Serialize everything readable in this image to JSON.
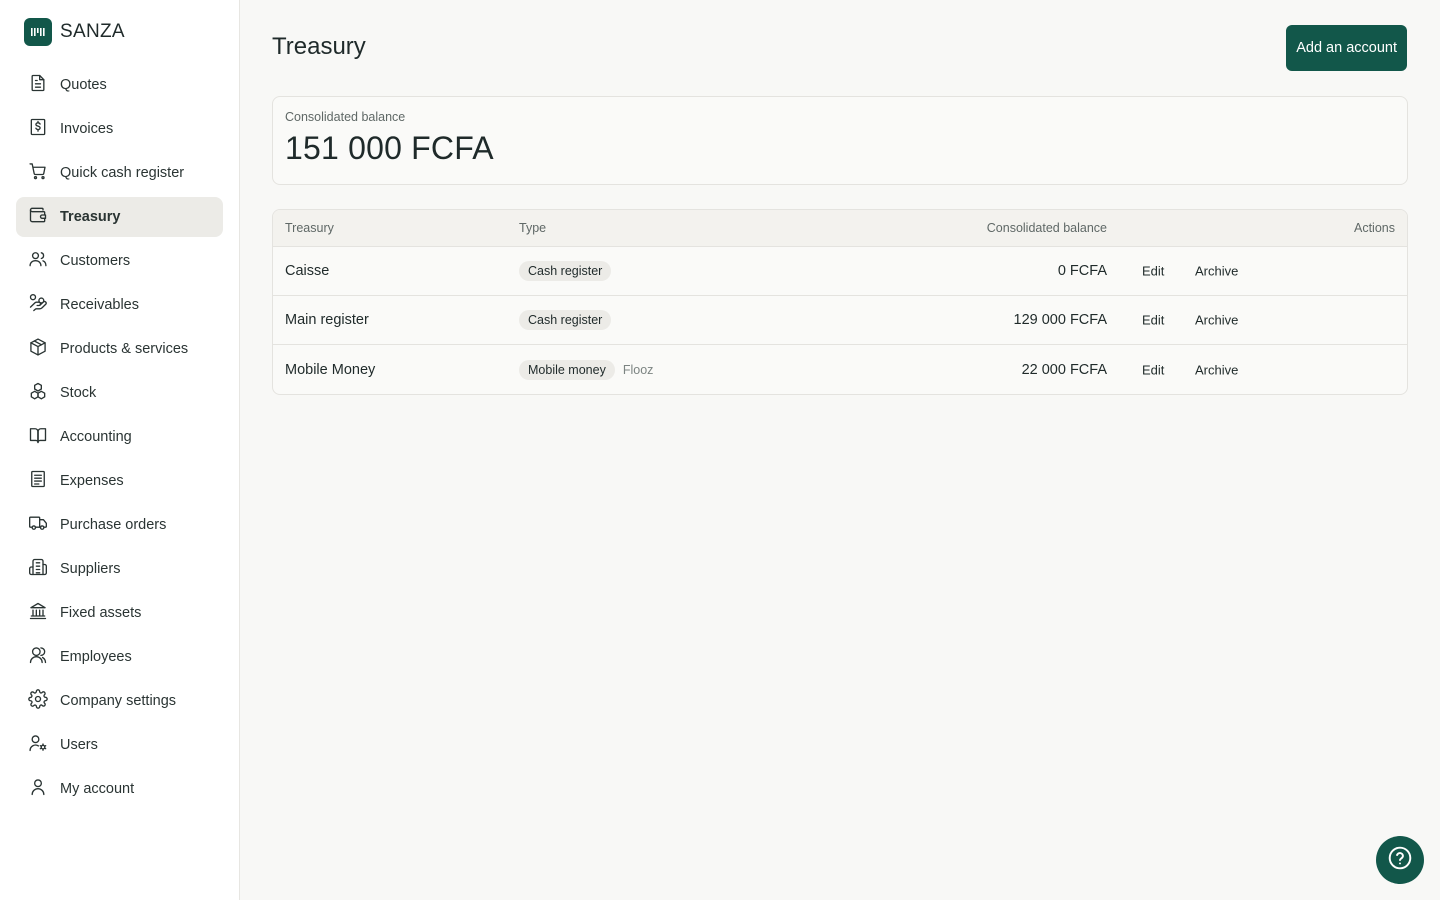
{
  "brand": {
    "name": "SANZA"
  },
  "sidebar": {
    "items": [
      {
        "label": "Quotes",
        "icon": "document-icon"
      },
      {
        "label": "Invoices",
        "icon": "invoice-dollar-icon"
      },
      {
        "label": "Quick cash register",
        "icon": "cart-icon"
      },
      {
        "label": "Treasury",
        "icon": "wallet-icon",
        "active": true
      },
      {
        "label": "Customers",
        "icon": "users-icon"
      },
      {
        "label": "Receivables",
        "icon": "hand-coins-icon"
      },
      {
        "label": "Products & services",
        "icon": "package-icon"
      },
      {
        "label": "Stock",
        "icon": "boxes-icon"
      },
      {
        "label": "Accounting",
        "icon": "book-icon"
      },
      {
        "label": "Expenses",
        "icon": "receipt-icon"
      },
      {
        "label": "Purchase orders",
        "icon": "truck-icon"
      },
      {
        "label": "Suppliers",
        "icon": "building-icon"
      },
      {
        "label": "Fixed assets",
        "icon": "landmark-icon"
      },
      {
        "label": "Employees",
        "icon": "employee-icon"
      },
      {
        "label": "Company settings",
        "icon": "gear-icon"
      },
      {
        "label": "Users",
        "icon": "user-cog-icon"
      },
      {
        "label": "My account",
        "icon": "user-icon"
      }
    ]
  },
  "header": {
    "title": "Treasury",
    "add_button": "Add an account"
  },
  "summary": {
    "label": "Consolidated balance",
    "value": "151 000 FCFA"
  },
  "table": {
    "headers": {
      "name": "Treasury",
      "type": "Type",
      "balance": "Consolidated balance",
      "actions": "Actions"
    },
    "rows": [
      {
        "name": "Caisse",
        "type": "Cash register",
        "provider": "",
        "balance": "0 FCFA",
        "edit": "Edit",
        "archive": "Archive"
      },
      {
        "name": "Main register",
        "type": "Cash register",
        "provider": "",
        "balance": "129 000 FCFA",
        "edit": "Edit",
        "archive": "Archive"
      },
      {
        "name": "Mobile Money",
        "type": "Mobile money",
        "provider": "Flooz",
        "balance": "22 000 FCFA",
        "edit": "Edit",
        "archive": "Archive"
      }
    ]
  },
  "colors": {
    "brand": "#12574a",
    "active_bg": "#ecebe7",
    "page_bg": "#f8f8f6"
  }
}
